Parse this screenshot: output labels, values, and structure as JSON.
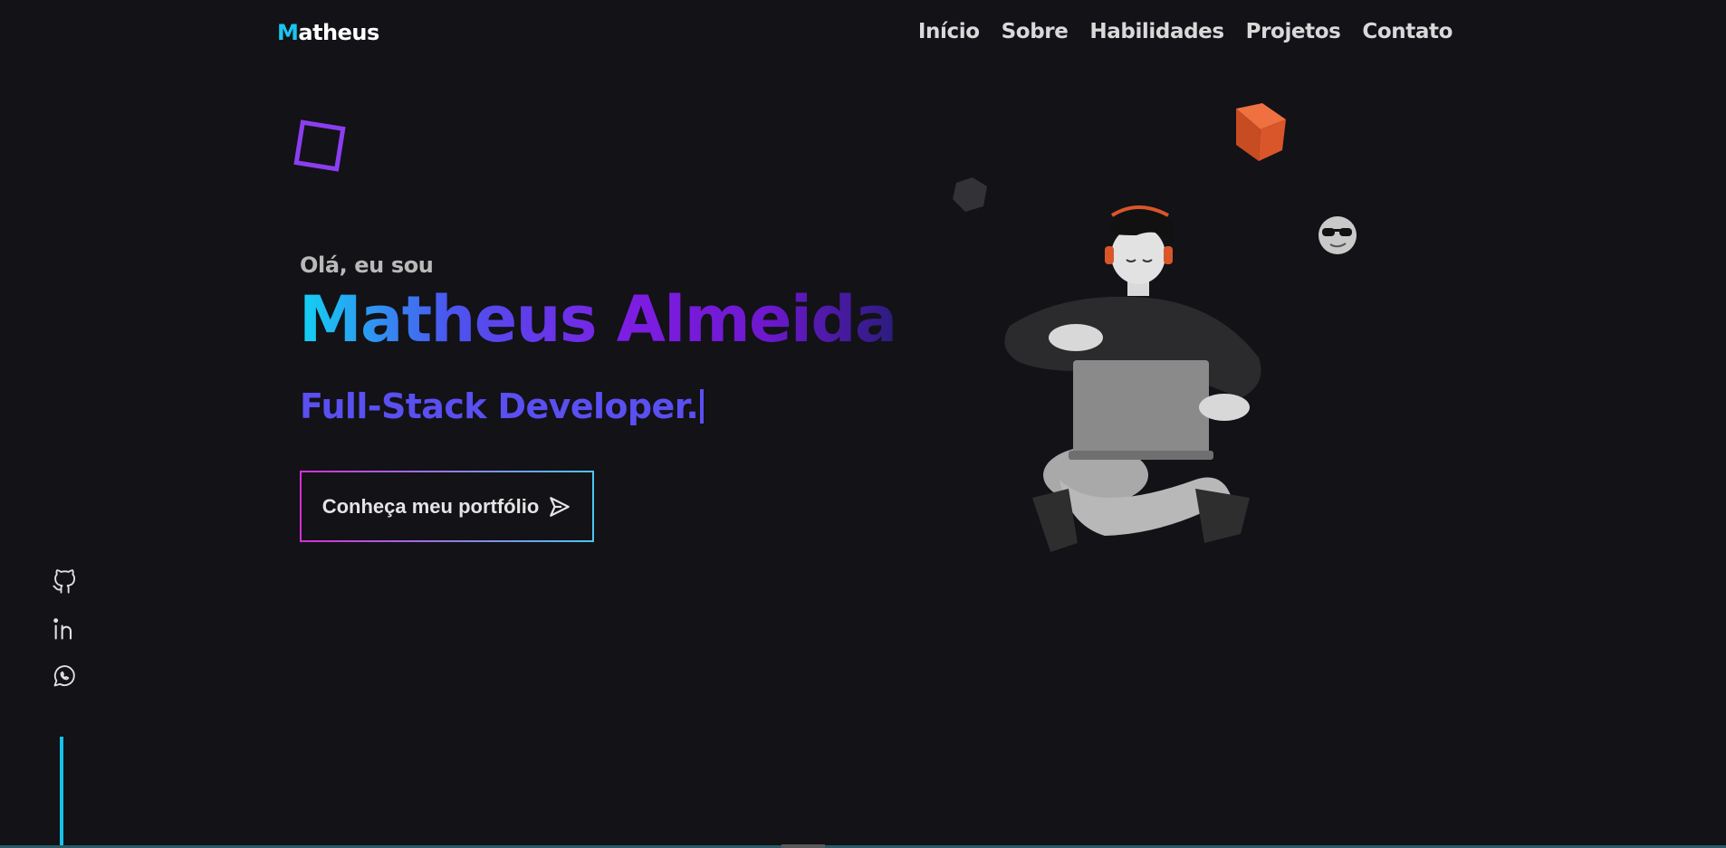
{
  "header": {
    "logo_first": "M",
    "logo_rest": "atheus",
    "nav": [
      "Início",
      "Sobre",
      "Habilidades",
      "Projetos",
      "Contato"
    ]
  },
  "hero": {
    "greeting": "Olá, eu sou",
    "name": "Matheus Almeida",
    "role": "Full-Stack Developer.",
    "cta_label": "Conheça meu portfólio"
  },
  "social": [
    "github-icon",
    "linkedin-icon",
    "whatsapp-icon"
  ],
  "colors": {
    "background": "#121217",
    "accent_cyan": "#19c6f0",
    "accent_purple": "#8a3ef0",
    "role_blue": "#5a4ff0",
    "cube_orange": "#d9562a"
  }
}
